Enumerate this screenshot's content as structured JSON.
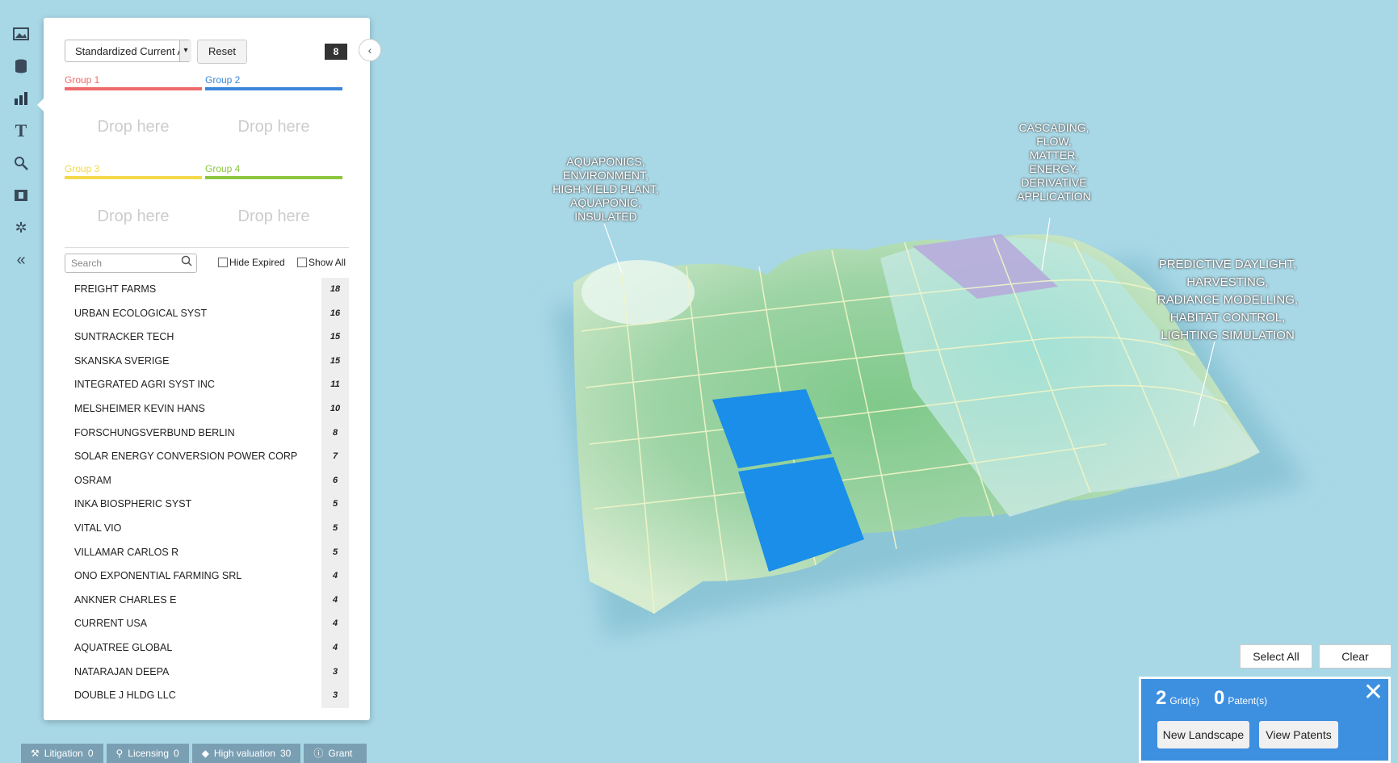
{
  "toolbar": {
    "icons": [
      "image-icon",
      "database-icon",
      "bar-chart-icon",
      "text-icon",
      "search-icon",
      "film-icon",
      "gear-icon",
      "collapse-icon"
    ]
  },
  "panel": {
    "select_value": "Standardized Current A",
    "reset_label": "Reset",
    "qr_label": "8",
    "groups": [
      {
        "label": "Group 1",
        "color": "#ef6b6b"
      },
      {
        "label": "Group 2",
        "color": "#3a87d9"
      },
      {
        "label": "Group 3",
        "color": "#f5d94a"
      },
      {
        "label": "Group 4",
        "color": "#8cc63f"
      }
    ],
    "drop_label": "Drop here",
    "search_placeholder": "Search",
    "hide_expired": "Hide Expired",
    "show_all": "Show All",
    "list": [
      {
        "name": "FREIGHT FARMS",
        "count": "18"
      },
      {
        "name": "URBAN ECOLOGICAL SYST",
        "count": "16"
      },
      {
        "name": "SUNTRACKER TECH",
        "count": "15"
      },
      {
        "name": "SKANSKA SVERIGE",
        "count": "15"
      },
      {
        "name": "INTEGRATED AGRI SYST INC",
        "count": "11"
      },
      {
        "name": "MELSHEIMER KEVIN HANS",
        "count": "10"
      },
      {
        "name": "FORSCHUNGSVERBUND BERLIN",
        "count": "8"
      },
      {
        "name": "SOLAR ENERGY CONVERSION POWER CORP",
        "count": "7"
      },
      {
        "name": "OSRAM",
        "count": "6"
      },
      {
        "name": "INKA BIOSPHERIC SYST",
        "count": "5"
      },
      {
        "name": "VITAL VIO",
        "count": "5"
      },
      {
        "name": "VILLAMAR CARLOS R",
        "count": "5"
      },
      {
        "name": "ONO EXPONENTIAL FARMING SRL",
        "count": "4"
      },
      {
        "name": "ANKNER CHARLES E",
        "count": "4"
      },
      {
        "name": "CURRENT USA",
        "count": "4"
      },
      {
        "name": "AQUATREE GLOBAL",
        "count": "4"
      },
      {
        "name": "NATARAJAN DEEPA",
        "count": "3"
      },
      {
        "name": "DOUBLE J HLDG LLC",
        "count": "3"
      }
    ]
  },
  "callouts": [
    {
      "text": "AQUAPONICS,\nENVIRONMENT,\nHIGH-YIELD PLANT,\nAQUAPONIC,\nINSULATED"
    },
    {
      "text": "CASCADING,\nFLOW,\nMATTER,\nENERGY,\nDERIVATIVE\nAPPLICATION"
    },
    {
      "text": "PREDICTIVE DAYLIGHT,\nHARVESTING,\nRADIANCE MODELLING,\nHABITAT CONTROL,\nLIGHTING SIMULATION"
    }
  ],
  "actions": {
    "select_all": "Select All",
    "clear": "Clear"
  },
  "selection": {
    "grids_count": "2",
    "grids_label": "Grid(s)",
    "patents_count": "0",
    "patents_label": "Patent(s)",
    "new_landscape": "New Landscape",
    "view_patents": "View Patents"
  },
  "bottom_tabs": [
    {
      "icon": "gavel-icon",
      "label": "Litigation",
      "count": "0"
    },
    {
      "icon": "ribbon-icon",
      "label": "Licensing",
      "count": "0"
    },
    {
      "icon": "diamond-icon",
      "label": "High valuation",
      "count": "30"
    },
    {
      "icon": "info-icon",
      "label": "Grant",
      "count": ""
    }
  ]
}
